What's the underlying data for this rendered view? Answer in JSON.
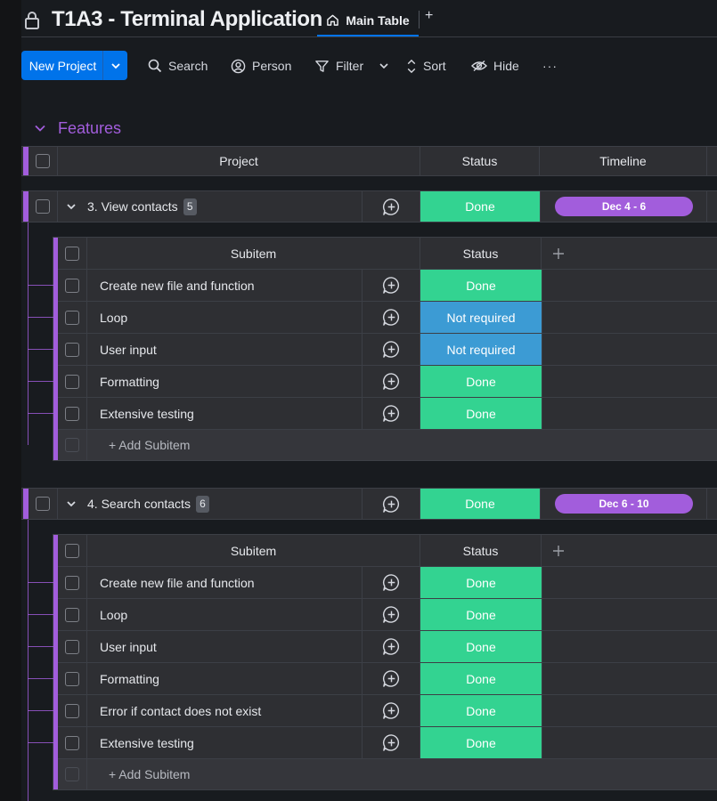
{
  "board": {
    "title": "T1A3 - Terminal Application",
    "tabs": [
      {
        "label": "Main Table",
        "icon": "home-icon"
      }
    ],
    "add_tab_label": "+"
  },
  "toolbar": {
    "new_project_label": "New Project",
    "search_label": "Search",
    "person_label": "Person",
    "filter_label": "Filter",
    "sort_label": "Sort",
    "hide_label": "Hide",
    "more_label": "···"
  },
  "group": {
    "title": "Features",
    "color": "#a25ddc",
    "columns": {
      "project": "Project",
      "status": "Status",
      "timeline": "Timeline"
    }
  },
  "subtable_columns": {
    "subitem": "Subitem",
    "status": "Status",
    "add": "+"
  },
  "add_subitem_label": "+ Add Subitem",
  "items": [
    {
      "name": "3. View contacts",
      "count": "5",
      "status": "Done",
      "timeline": "Dec 4 - 6",
      "subitems": [
        {
          "name": "Create new file and function",
          "status": "Done"
        },
        {
          "name": "Loop",
          "status": "Not required"
        },
        {
          "name": "User input",
          "status": "Not required"
        },
        {
          "name": "Formatting",
          "status": "Done"
        },
        {
          "name": "Extensive testing",
          "status": "Done"
        }
      ]
    },
    {
      "name": "4. Search contacts",
      "count": "6",
      "status": "Done",
      "timeline": "Dec 6 - 10",
      "subitems": [
        {
          "name": "Create new file and function",
          "status": "Done"
        },
        {
          "name": "Loop",
          "status": "Done"
        },
        {
          "name": "User input",
          "status": "Done"
        },
        {
          "name": "Formatting",
          "status": "Done"
        },
        {
          "name": "Error if contact does not exist",
          "status": "Done"
        },
        {
          "name": "Extensive testing",
          "status": "Done"
        }
      ]
    }
  ],
  "colors": {
    "done": "#33d391",
    "not_required": "#3c9bd4",
    "accent": "#0073ea",
    "group": "#a25ddc"
  }
}
